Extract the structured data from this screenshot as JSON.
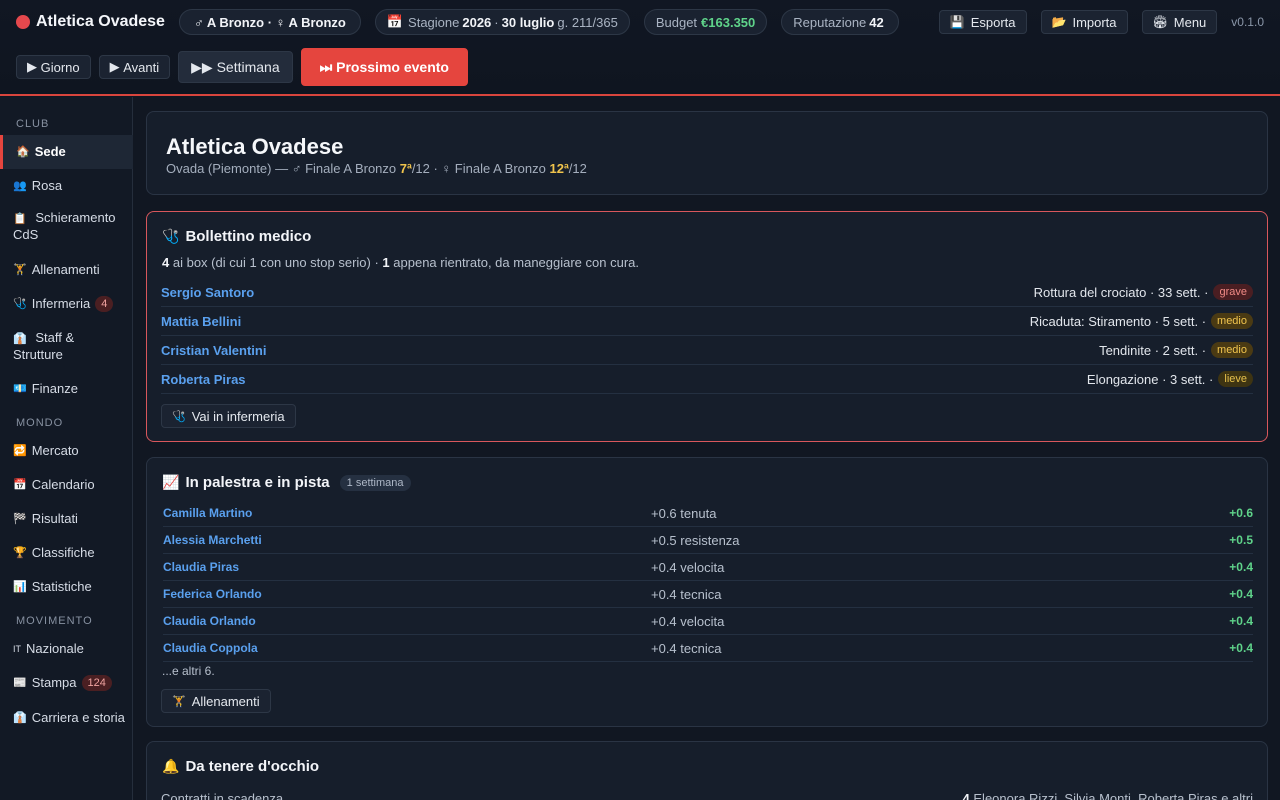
{
  "header": {
    "club_name": "Atletica Ovadese",
    "league_pill": "♂ A Bronzo · ♀ A Bronzo",
    "season_label": "Stagione",
    "season_year": "2026",
    "date": "30 luglio",
    "day": "g. 211/365",
    "budget_label": "Budget",
    "budget_value": "€163.350",
    "reputation_label": "Reputazione",
    "reputation_value": "42",
    "export_label": "Esporta",
    "import_label": "Importa",
    "menu_label": "Menu",
    "version": "v0.1.0",
    "accent_color": "#e5453e"
  },
  "controls": {
    "day_label": "Giorno",
    "next_label": "Avanti",
    "week_label": "Settimana",
    "event_label": "Prossimo evento"
  },
  "sidebar": {
    "sections": [
      {
        "title": "CLUB",
        "items": [
          {
            "label": "Sede",
            "icon": "home-icon",
            "active": true
          },
          {
            "label": "Rosa",
            "icon": "people-icon"
          },
          {
            "label": "Schieramento CdS",
            "icon": "clipboard-icon"
          },
          {
            "label": "Allenamenti",
            "icon": "dumbbell-icon"
          },
          {
            "label": "Infermeria",
            "icon": "stethoscope-icon",
            "badge": "4"
          },
          {
            "label": "Staff & Strutture",
            "icon": "staff-icon"
          },
          {
            "label": "Finanze",
            "icon": "money-icon"
          }
        ]
      },
      {
        "title": "MONDO",
        "items": [
          {
            "label": "Mercato",
            "icon": "transfer-icon"
          },
          {
            "label": "Calendario",
            "icon": "calendar-icon"
          },
          {
            "label": "Risultati",
            "icon": "checkered-flag-icon"
          },
          {
            "label": "Classifiche",
            "icon": "trophy-icon"
          },
          {
            "label": "Statistiche",
            "icon": "bar-chart-icon"
          }
        ]
      },
      {
        "title": "MOVIMENTO",
        "items": [
          {
            "label": "Nazionale",
            "icon": "flag-it-icon"
          },
          {
            "label": "Stampa",
            "icon": "newspaper-icon",
            "badge": "124"
          },
          {
            "label": "Carriera e storia",
            "icon": "career-icon"
          }
        ]
      }
    ]
  },
  "club_card": {
    "title": "Atletica Ovadese",
    "subtitle_prefix": "Ovada (Piemonte) — ♂ Finale A Bronzo",
    "men_rank": "7ª",
    "men_total": "/12 · ♀ Finale A Bronzo",
    "women_rank": "12ª",
    "women_total": "/12"
  },
  "medical": {
    "title": "Bollettino medico",
    "count_box": "4",
    "summary_1": "ai box (di cui 1 con uno stop serio) ·",
    "count_back": "1",
    "summary_2": "appena rientrato, da maneggiare con cura.",
    "injuries": [
      {
        "name": "Sergio Santoro",
        "detail": "Rottura del crociato · 33 sett. ·",
        "severity": "grave"
      },
      {
        "name": "Mattia Bellini",
        "detail": "Ricaduta: Stiramento · 5 sett. ·",
        "severity": "medio"
      },
      {
        "name": "Cristian Valentini",
        "detail": "Tendinite · 2 sett. ·",
        "severity": "medio"
      },
      {
        "name": "Roberta Piras",
        "detail": "Elongazione · 3 sett. ·",
        "severity": "lieve"
      }
    ],
    "button_label": "Vai in infermeria"
  },
  "training": {
    "title": "In palestra e in pista",
    "tag": "1 settimana",
    "rows": [
      {
        "name": "Camilla Martino",
        "delta": "+0.6 tenuta",
        "total": "+0.6"
      },
      {
        "name": "Alessia Marchetti",
        "delta": "+0.5 resistenza",
        "total": "+0.5"
      },
      {
        "name": "Claudia Piras",
        "delta": "+0.4 velocita",
        "total": "+0.4"
      },
      {
        "name": "Federica Orlando",
        "delta": "+0.4 tecnica",
        "total": "+0.4"
      },
      {
        "name": "Claudia Orlando",
        "delta": "+0.4 velocita",
        "total": "+0.4"
      },
      {
        "name": "Claudia Coppola",
        "delta": "+0.4 tecnica",
        "total": "+0.4"
      }
    ],
    "more": "...e altri 6.",
    "button_label": "Allenamenti"
  },
  "watch": {
    "title": "Da tenere d'occhio",
    "row_label": "Contratti in scadenza",
    "row_count": "4",
    "row_value": "Eleonora Rizzi, Silvia Monti, Roberta Piras e altri"
  }
}
